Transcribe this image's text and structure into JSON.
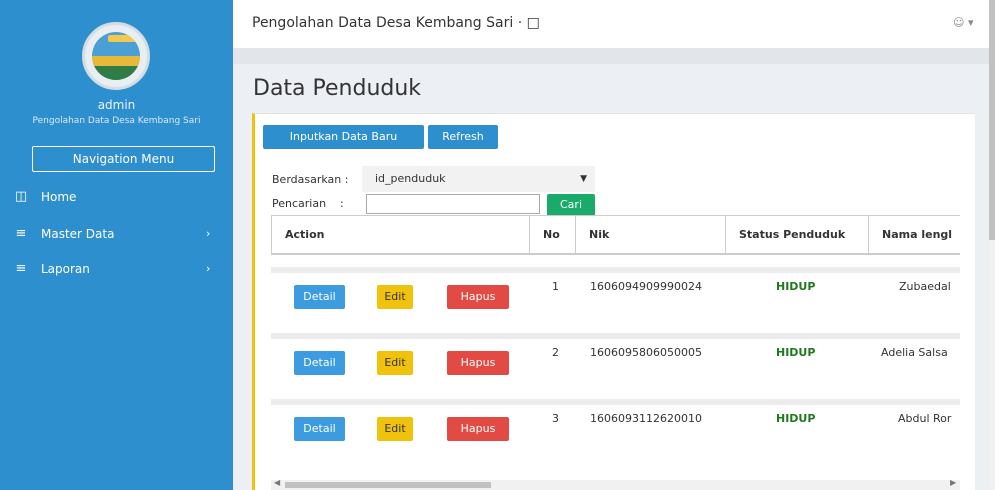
{
  "app": {
    "title": "Pengolahan Data Desa Kembang Sari ·",
    "user_menu_icon": "user-icon"
  },
  "sidebar": {
    "user_name": "admin",
    "user_subtitle": "Pengolahan Data Desa Kembang Sari",
    "nav_menu_label": "Navigation Menu",
    "items": [
      {
        "label": "Home",
        "icon": "home-icon",
        "has_submenu": false
      },
      {
        "label": "Master Data",
        "icon": "list-icon",
        "has_submenu": true
      },
      {
        "label": "Laporan",
        "icon": "list-icon",
        "has_submenu": true
      }
    ]
  },
  "page": {
    "title": "Data Penduduk"
  },
  "toolbar": {
    "new_label": "Inputkan Data Baru",
    "refresh_label": "Refresh"
  },
  "filter": {
    "by_label": "Berdasarkan :",
    "by_value": "id_penduduk",
    "search_label": "Pencarian    :",
    "search_value": "",
    "search_button": "Cari"
  },
  "table": {
    "headers": [
      "Action",
      "No",
      "Nik",
      "Status Penduduk",
      "Nama lengl"
    ],
    "action_labels": {
      "detail": "Detail",
      "edit": "Edit",
      "hapus": "Hapus"
    },
    "rows": [
      {
        "no": "1",
        "nik": "1606094909990024",
        "status": "HIDUP",
        "nama": "Zubaedal"
      },
      {
        "no": "2",
        "nik": "1606095806050005",
        "status": "HIDUP",
        "nama": "Adelia Salsa"
      },
      {
        "no": "3",
        "nik": "1606093112620010",
        "status": "HIDUP",
        "nama": "Abdul Ror"
      }
    ]
  },
  "colors": {
    "sidebar": "#2e8fcf",
    "accent_border": "#f0c20d",
    "status_alive": "#1f7a1f",
    "delete": "#e14b43"
  }
}
